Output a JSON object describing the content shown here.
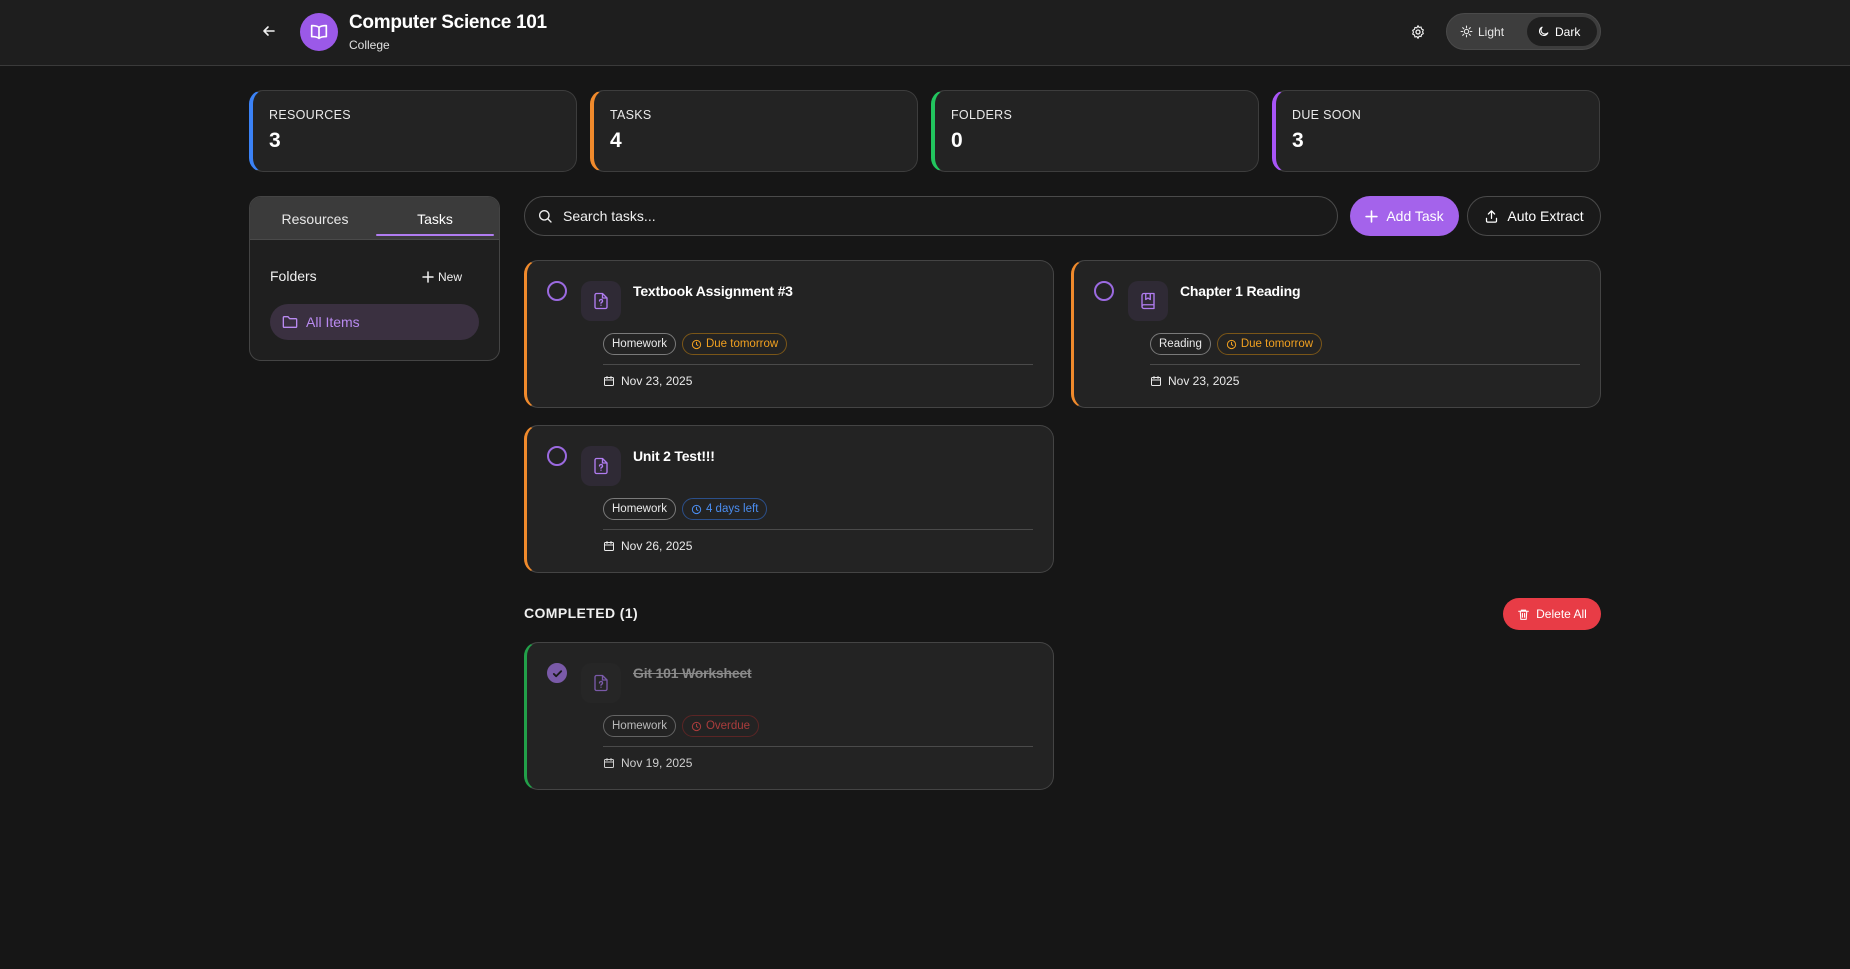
{
  "header": {
    "title": "Computer Science 101",
    "subtitle": "College",
    "theme": {
      "light_label": "Light",
      "dark_label": "Dark",
      "selected": "Dark"
    }
  },
  "stats": [
    {
      "label": "RESOURCES",
      "value": "3",
      "accent": "#3b82f6"
    },
    {
      "label": "TASKS",
      "value": "4",
      "accent": "#f08a2c"
    },
    {
      "label": "FOLDERS",
      "value": "0",
      "accent": "#22c55e"
    },
    {
      "label": "DUE SOON",
      "value": "3",
      "accent": "#a855f7"
    }
  ],
  "sidebar": {
    "tabs": [
      {
        "label": "Resources"
      },
      {
        "label": "Tasks",
        "active": true
      }
    ],
    "folders_label": "Folders",
    "new_label": "New",
    "all_items_label": "All Items"
  },
  "toolbar": {
    "search_placeholder": "Search tasks...",
    "add_task_label": "Add Task",
    "auto_extract_label": "Auto Extract"
  },
  "tasks": [
    {
      "title": "Textbook Assignment #3",
      "icon": "file-question-icon",
      "category": "Homework",
      "due": "Due tomorrow",
      "due_status": "warn",
      "date": "Nov 23, 2025"
    },
    {
      "title": "Chapter 1 Reading",
      "icon": "book-icon",
      "category": "Reading",
      "due": "Due tomorrow",
      "due_status": "warn",
      "date": "Nov 23, 2025"
    },
    {
      "title": "Unit 2 Test!!!",
      "icon": "file-question-icon",
      "category": "Homework",
      "due": "4 days left",
      "due_status": "info",
      "date": "Nov 26, 2025"
    }
  ],
  "completed": {
    "heading": "COMPLETED (1)",
    "delete_all_label": "Delete All",
    "items": [
      {
        "title": "Git 101 Worksheet",
        "icon": "file-question-icon",
        "category": "Homework",
        "due": "Overdue",
        "due_status": "err",
        "date": "Nov 19, 2025"
      }
    ]
  },
  "colors": {
    "accent_purple": "#a463eb",
    "danger": "#e83c46",
    "warn": "#f0a020",
    "info": "#4b8df0"
  }
}
